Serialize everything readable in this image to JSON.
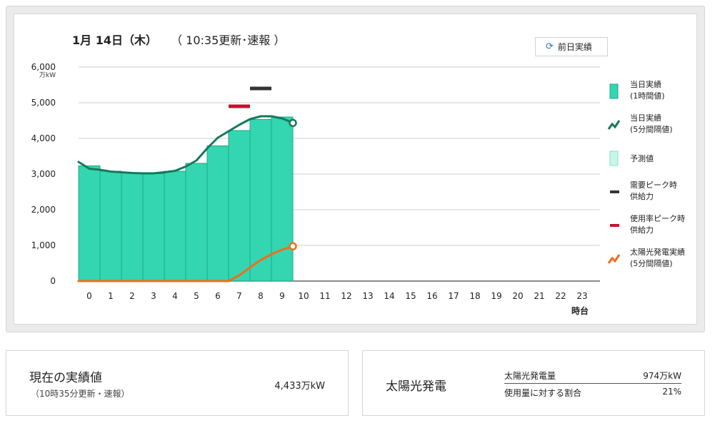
{
  "header": {
    "date": "1月 14日（木）",
    "update": "（ 10:35更新･速報 ）",
    "prev_button_label": "前日実績",
    "prev_button_icon": "refresh-icon"
  },
  "chart_data": {
    "type": "bar",
    "title": "1月 14日（木）",
    "yunit": "万kW",
    "xlabel": "時台",
    "ylim": [
      0,
      6000
    ],
    "yticks": [
      "0",
      "1,000",
      "2,000",
      "3,000",
      "4,000",
      "5,000",
      "6,000"
    ],
    "hours": [
      0,
      1,
      2,
      3,
      4,
      5,
      6,
      7,
      8,
      9,
      10,
      11,
      12,
      13,
      14,
      15,
      16,
      17,
      18,
      19,
      20,
      21,
      22,
      23
    ],
    "series": [
      {
        "name": "当日実績 (1時間値)",
        "type": "bar",
        "color": "#33d6b0",
        "values": [
          3230,
          3080,
          3040,
          3010,
          3080,
          3300,
          3790,
          4220,
          4530,
          4600
        ]
      },
      {
        "name": "当日実績 (5分間隔値)",
        "type": "line",
        "color": "#17795a",
        "x": [
          0,
          0.5,
          1,
          1.5,
          2,
          2.5,
          3,
          3.5,
          4,
          4.5,
          5,
          5.5,
          6,
          6.5,
          7,
          7.5,
          8,
          8.5,
          9,
          9.5,
          10
        ],
        "y": [
          3340,
          3150,
          3120,
          3070,
          3050,
          3030,
          3020,
          3020,
          3050,
          3090,
          3210,
          3380,
          3720,
          4020,
          4200,
          4380,
          4540,
          4620,
          4620,
          4560,
          4433
        ]
      },
      {
        "name": "太陽光発電実績 (5分間隔値)",
        "type": "line",
        "color": "#f26d1a",
        "x": [
          0,
          6.5,
          7,
          7.5,
          8,
          8.5,
          9,
          9.5,
          10
        ],
        "y": [
          0,
          0,
          0,
          160,
          380,
          590,
          750,
          880,
          974
        ]
      }
    ],
    "peaks": {
      "demand_peak": {
        "name": "需要ピーク時供給力",
        "hour": 8,
        "value": 5400,
        "color": "#333333"
      },
      "usage_peak": {
        "name": "使用率ピーク時供給力",
        "hour": 7,
        "value": 4900,
        "color": "#c8102e"
      }
    },
    "legend_position": "right",
    "legend": [
      {
        "icon": "bar-actual",
        "line1": "当日実績",
        "line2": "(1時間値)"
      },
      {
        "icon": "line-actual",
        "line1": "当日実績",
        "line2": "(5分間隔値)"
      },
      {
        "icon": "bar-forecast",
        "line1": "予測値",
        "line2": ""
      },
      {
        "icon": "mark-demand",
        "line1": "需要ピーク時",
        "line2": "供給力"
      },
      {
        "icon": "mark-usage",
        "line1": "使用率ピーク時",
        "line2": "供給力"
      },
      {
        "icon": "line-solar",
        "line1": "太陽光発電実績",
        "line2": "(5分間隔値)"
      }
    ]
  },
  "current": {
    "title": "現在の実績値",
    "subtitle": "（10時35分更新・速報）",
    "value": "4,433万kW"
  },
  "solar": {
    "title": "太陽光発電",
    "rows": [
      {
        "label": "太陽光発電量",
        "value": "974万kW"
      },
      {
        "label": "使用量に対する割合",
        "value": "21%"
      }
    ]
  }
}
